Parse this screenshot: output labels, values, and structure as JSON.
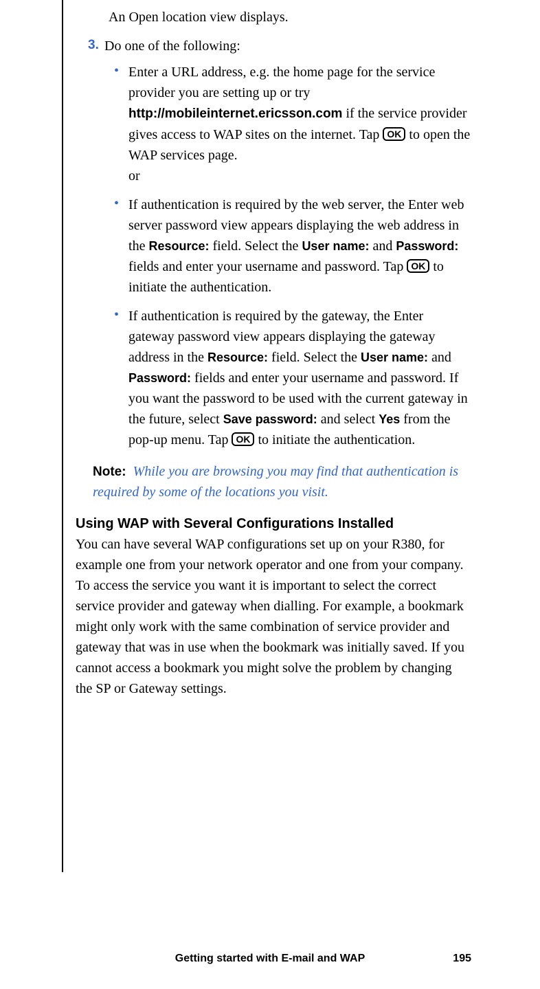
{
  "intro": "An Open location view displays.",
  "step": {
    "num": "3.",
    "text": "Do one of the following:"
  },
  "bullets": {
    "b1": {
      "part1": "Enter a URL address, e.g. the home page for the service provider you are setting up or try ",
      "url": "http://mobileinternet.ericsson.com",
      "part2": " if the service provider gives access to WAP sites on the internet. Tap ",
      "ok": "OK",
      "part3": " to open the WAP services page.",
      "or": "or"
    },
    "b2": {
      "part1": "If authentication is required by the web server, the Enter web server password view appears displaying the web address in the ",
      "resource": "Resource:",
      "part2": " field. Select the ",
      "username": "User name:",
      "part3": " and ",
      "password": "Password:",
      "part4": " fields and enter your username and password. Tap ",
      "ok": "OK",
      "part5": " to initiate the authentication."
    },
    "b3": {
      "part1": "If authentication is required by the gateway, the Enter gateway password view appears displaying the gateway address in the ",
      "resource": "Resource:",
      "part2": " field. Select the ",
      "username": "User name:",
      "part3": " and ",
      "password": "Password:",
      "part4": " fields and enter your username and password. If you want the password to be used with the current gateway in the future, select ",
      "savepw": "Save password:",
      "part5": " and select ",
      "yes": "Yes",
      "part6": " from the pop-up menu. Tap ",
      "ok": "OK",
      "part7": " to initiate the authentication."
    }
  },
  "note": {
    "label": "Note:",
    "text": "While you are browsing you may find that authentication is required by some of the locations you visit."
  },
  "section": {
    "heading": "Using WAP with Several Configurations Installed",
    "body": "You can have several WAP configurations set up on your R380, for example one from your network operator and one from your company. To access the service you want it is important to select the correct service provider and gateway when dialling. For example, a bookmark might only work with the same combination of service provider and gateway that was in use when the bookmark was initially saved. If you cannot access a bookmark you might solve the problem by changing the SP or Gateway settings."
  },
  "footer": {
    "title": "Getting started with E-mail and WAP",
    "page": "195"
  }
}
